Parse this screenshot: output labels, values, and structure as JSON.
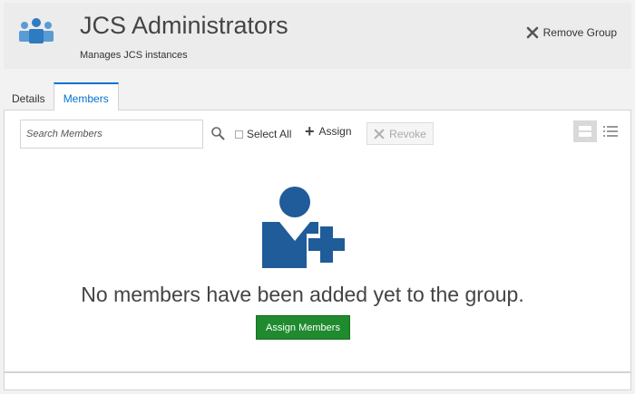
{
  "header": {
    "icon": "group-icon",
    "title": "JCS Administrators",
    "subtitle": "Manages JCS instances",
    "remove_label": "Remove Group"
  },
  "tabs": [
    {
      "label": "Details",
      "active": false
    },
    {
      "label": "Members",
      "active": true
    }
  ],
  "toolbar": {
    "search_placeholder": "Search Members",
    "select_all_label": "Select All",
    "select_all_checked": false,
    "assign_label": "Assign",
    "revoke_label": "Revoke",
    "revoke_enabled": false,
    "view_mode": "card"
  },
  "empty_state": {
    "icon": "add-member-icon",
    "message": "No members have been added yet to the group.",
    "button_label": "Assign Members"
  },
  "colors": {
    "accent": "#0572ce",
    "icon_blue": "#1f5c99",
    "primary_button": "#1f8a2e",
    "header_bg": "#ececec"
  }
}
